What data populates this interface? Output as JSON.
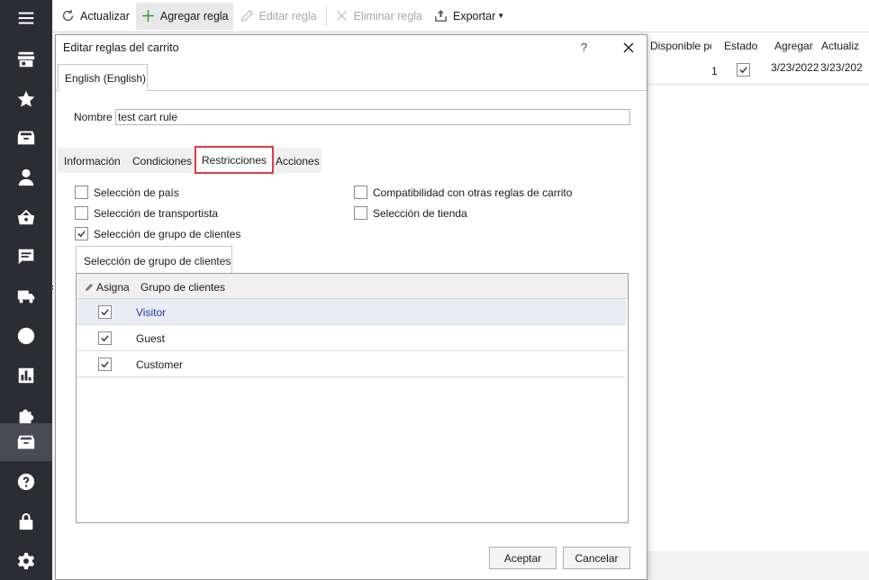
{
  "toolbar": {
    "refresh_label": "Actualizar",
    "add_label": "Agregar regla",
    "edit_label": "Editar regla",
    "delete_label": "Eliminar regla",
    "export_label": "Exportar"
  },
  "grid": {
    "columns": [
      "Disponible pc",
      "Estado",
      "Agregar",
      "Actualiz"
    ],
    "row": {
      "available": "1",
      "status_checked": true,
      "added": "3/23/2022",
      "updated": "3/23/202"
    }
  },
  "dialog": {
    "title": "Editar reglas del carrito",
    "help": "?",
    "language_tab": "English (English)",
    "name_label": "Nombre",
    "name_value": "test cart rule",
    "tabs": [
      "Información",
      "Condiciones",
      "Restricciones",
      "Acciones"
    ],
    "active_tab": "Restricciones",
    "restrictions": [
      {
        "label": "Selección de país",
        "checked": false
      },
      {
        "label": "Selección de transportista",
        "checked": false
      },
      {
        "label": "Selección de grupo de clientes",
        "checked": true
      },
      {
        "label": "Compatibilidad con otras reglas de carrito",
        "checked": false
      },
      {
        "label": "Selección de tienda",
        "checked": false
      }
    ],
    "subtab": "Selección de grupo de clientes",
    "table": {
      "col_assign": "Asigna",
      "col_group": "Grupo de clientes",
      "rows": [
        {
          "checked": true,
          "name": "Visitor"
        },
        {
          "checked": true,
          "name": "Guest"
        },
        {
          "checked": true,
          "name": "Customer"
        }
      ]
    },
    "ok_label": "Aceptar",
    "cancel_label": "Cancelar"
  },
  "colors": {
    "sidebar_bg": "#2b2c34",
    "active_tab_border": "#e03c3c",
    "selected_row_text": "#2f3aa3",
    "add_icon": "#2e9e3a"
  },
  "sidebar_icons": [
    "menu-icon",
    "store-icon",
    "star-icon",
    "box-icon",
    "user-icon",
    "basket-icon",
    "message-icon",
    "truck-icon",
    "globe-icon",
    "chart-icon",
    "puzzle-icon",
    "archive-icon",
    "help-icon",
    "lock-icon",
    "gear-icon"
  ]
}
